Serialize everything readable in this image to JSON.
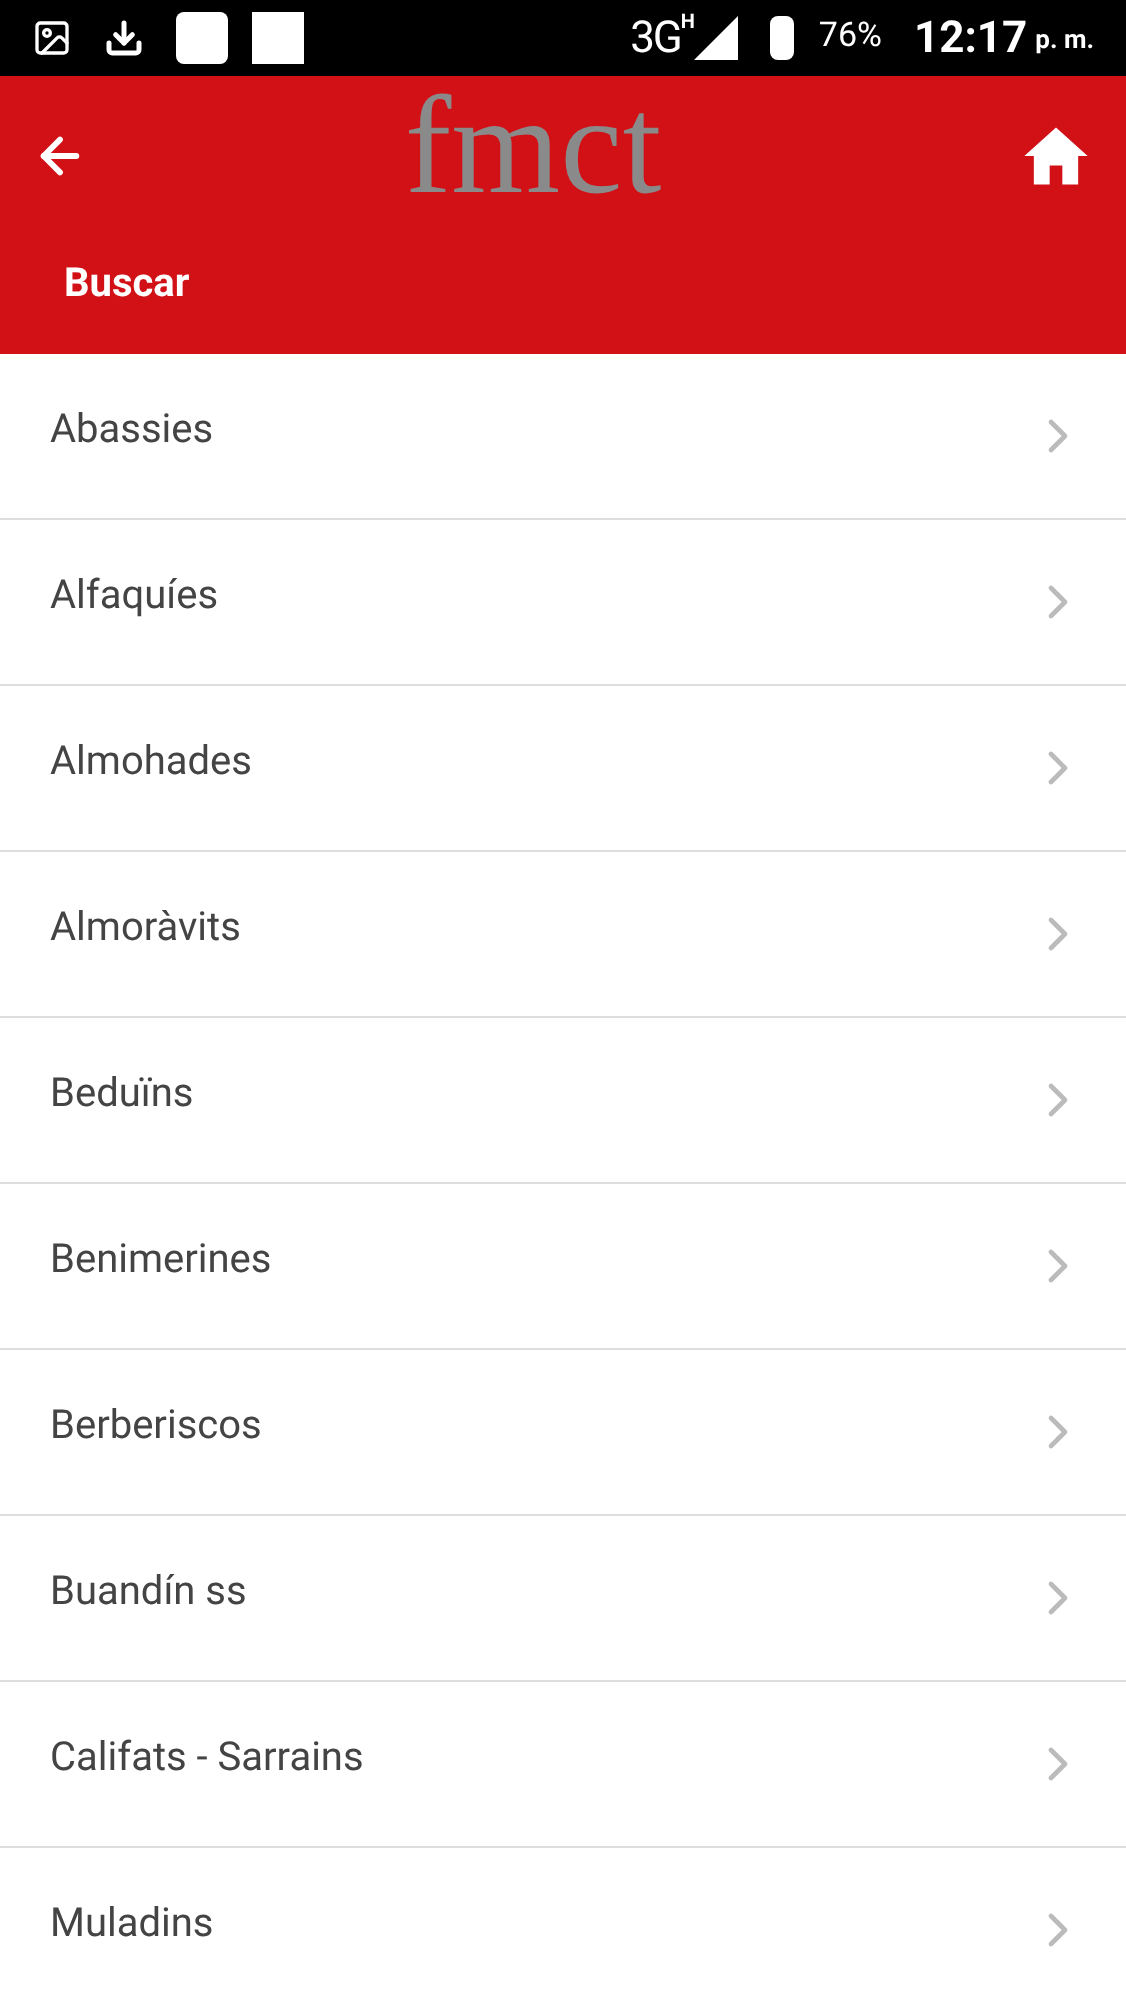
{
  "status_bar": {
    "network": "3G",
    "network_sub": "H",
    "battery": "76%",
    "time": "12:17",
    "ampm": "p. m."
  },
  "header": {
    "logo": "fmct",
    "search_label": "Buscar"
  },
  "items": [
    {
      "label": "Abassies"
    },
    {
      "label": "Alfaquíes"
    },
    {
      "label": "Almohades"
    },
    {
      "label": "Almoràvits"
    },
    {
      "label": "Beduïns"
    },
    {
      "label": "Benimerines"
    },
    {
      "label": "Berberiscos"
    },
    {
      "label": "Buandín ss"
    },
    {
      "label": "Califats - Sarrains"
    },
    {
      "label": "Muladins"
    }
  ]
}
